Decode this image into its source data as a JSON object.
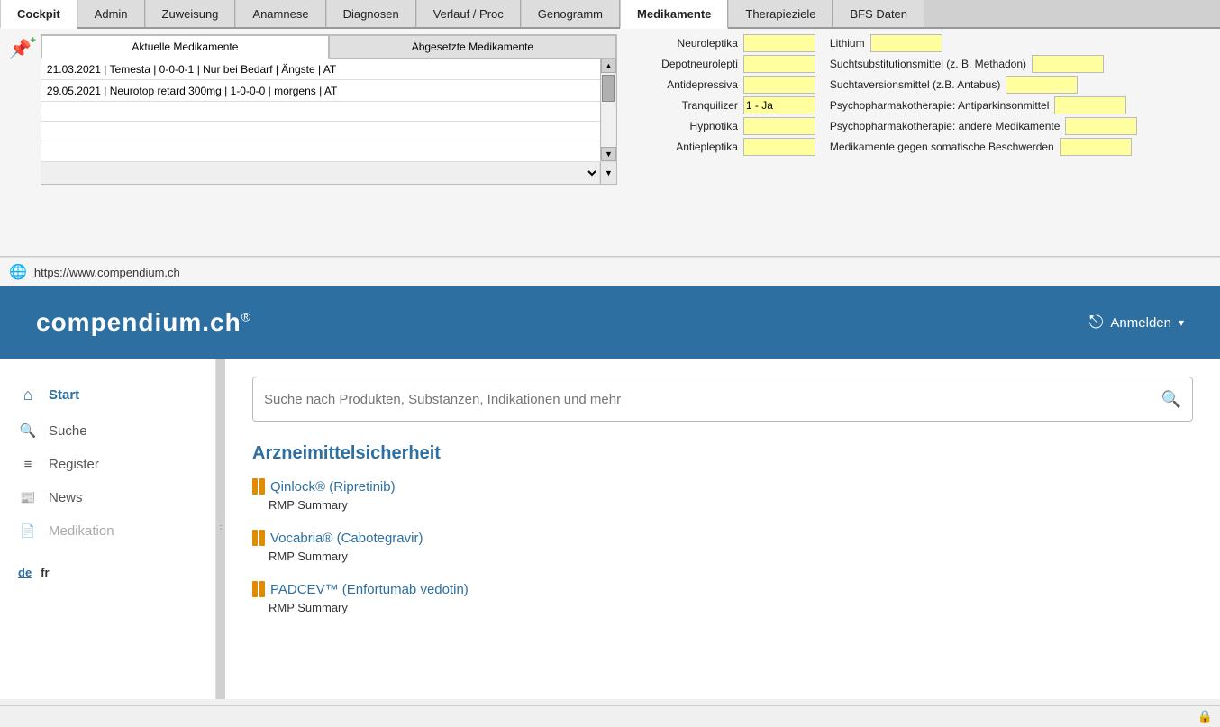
{
  "tabs": [
    {
      "label": "Cockpit",
      "active": false
    },
    {
      "label": "Admin",
      "active": false
    },
    {
      "label": "Zuweisung",
      "active": false
    },
    {
      "label": "Anamnese",
      "active": false
    },
    {
      "label": "Diagnosen",
      "active": false
    },
    {
      "label": "Verlauf / Proc",
      "active": false
    },
    {
      "label": "Genogramm",
      "active": false
    },
    {
      "label": "Medikamente",
      "active": true
    },
    {
      "label": "Therapieziele",
      "active": false
    },
    {
      "label": "BFS Daten",
      "active": false
    }
  ],
  "med_tabs": [
    {
      "label": "Aktuelle Medikamente",
      "active": true
    },
    {
      "label": "Abgesetzte Medikamente",
      "active": false
    }
  ],
  "med_rows": [
    {
      "text": "21.03.2021   |   Temesta   |   0-0-0-1   |   Nur bei Bedarf   |   Ängste   |   AT"
    },
    {
      "text": "29.05.2021   |   Neurotop retard 300mg   |   1-0-0-0   |   morgens   |   AT"
    },
    {
      "text": ""
    },
    {
      "text": ""
    },
    {
      "text": ""
    }
  ],
  "categories": [
    {
      "label": "Neuroleptika",
      "value": "",
      "label2": "Lithium",
      "value2": ""
    },
    {
      "label": "Depotneurolepti",
      "value": "",
      "label2": "Suchtsubstitutionsmittel (z. B. Methadon)",
      "value2": ""
    },
    {
      "label": "Antidepressiva",
      "value": "",
      "label2": "Suchtaversionsmittel (z.B. Antabus)",
      "value2": ""
    },
    {
      "label": "Tranquilizer",
      "value": "1 - Ja",
      "label2": "Psychopharmakotherapie: Antiparkinsonmittel",
      "value2": ""
    },
    {
      "label": "Hypnotika",
      "value": "",
      "label2": "Psychopharmakotherapie: andere Medikamente",
      "value2": ""
    },
    {
      "label": "Antiepleptika",
      "value": "",
      "label2": "Medikamente gegen somatische Beschwerden",
      "value2": ""
    }
  ],
  "url": "https://www.compendium.ch",
  "compendium": {
    "logo": "compendium.ch",
    "logo_reg": "®",
    "anmelden": "Anmelden"
  },
  "sidebar": {
    "items": [
      {
        "label": "Start",
        "icon": "⌂",
        "active": true
      },
      {
        "label": "Suche",
        "icon": "🔍",
        "active": false
      },
      {
        "label": "Register",
        "icon": "≡",
        "active": false
      },
      {
        "label": "News",
        "icon": "📰",
        "active": false
      },
      {
        "label": "Medikation",
        "icon": "📄",
        "active": false
      }
    ],
    "lang": [
      {
        "label": "de",
        "active": true
      },
      {
        "label": "fr",
        "active": false
      }
    ]
  },
  "search": {
    "placeholder": "Suche nach Produkten, Substanzen, Indikationen und mehr"
  },
  "section_title": "Arzneimittelsicherheit",
  "news_items": [
    {
      "title": "Qinlock® (Ripretinib)",
      "subtitle": "RMP Summary"
    },
    {
      "title": "Vocabria® (Cabotegravir)",
      "subtitle": "RMP Summary"
    },
    {
      "title": "PADCEV™ (Enfortumab vedotin)",
      "subtitle": "RMP Summary"
    }
  ]
}
